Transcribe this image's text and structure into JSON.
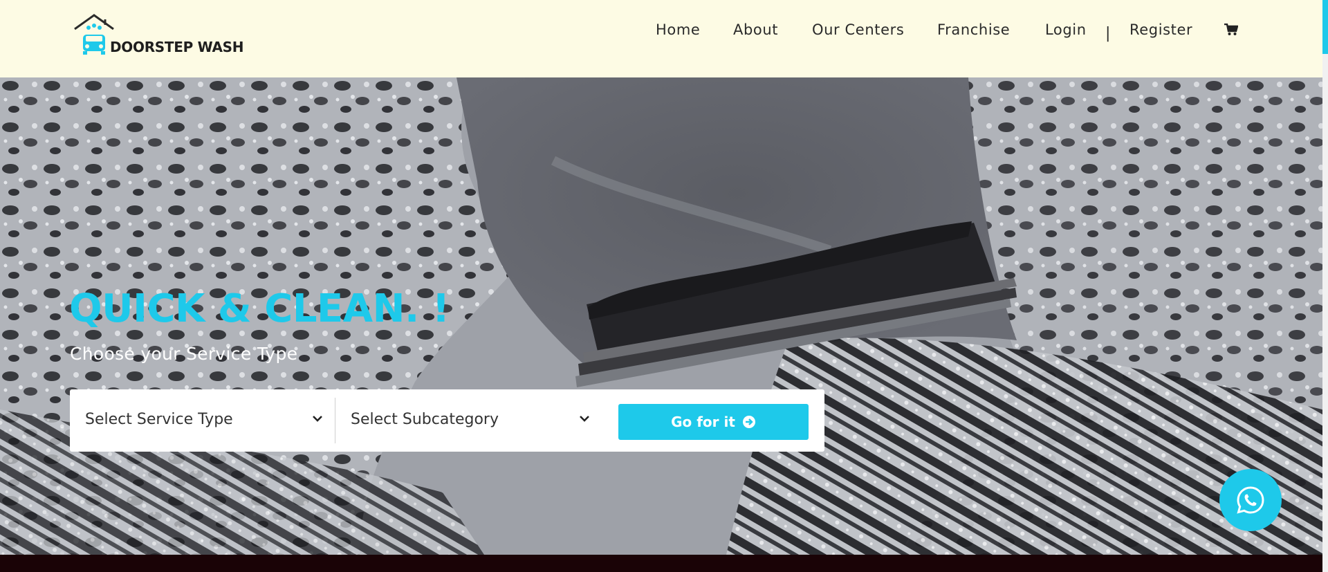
{
  "brand": {
    "name": "DOORSTEP WASH",
    "accent_color": "#1ec9ea"
  },
  "nav": {
    "items": [
      {
        "label": "Home"
      },
      {
        "label": "About"
      },
      {
        "label": "Our Centers"
      },
      {
        "label": "Franchise"
      },
      {
        "label": "Login"
      },
      {
        "label": "Register"
      }
    ],
    "separator": "|",
    "cart_icon": "shopping-cart-icon"
  },
  "hero": {
    "title": "QUICK & CLEAN. !",
    "subtitle": "Choose your Service Type",
    "service_select": {
      "value": "Select Service Type",
      "icon": "chevron-down-icon"
    },
    "subcategory_select": {
      "value": "Select Subcategory",
      "icon": "chevron-down-icon"
    },
    "go_button": {
      "label": "Go for it",
      "icon": "arrow-circle-right-icon"
    }
  },
  "floating": {
    "whatsapp_icon": "whatsapp-icon"
  }
}
